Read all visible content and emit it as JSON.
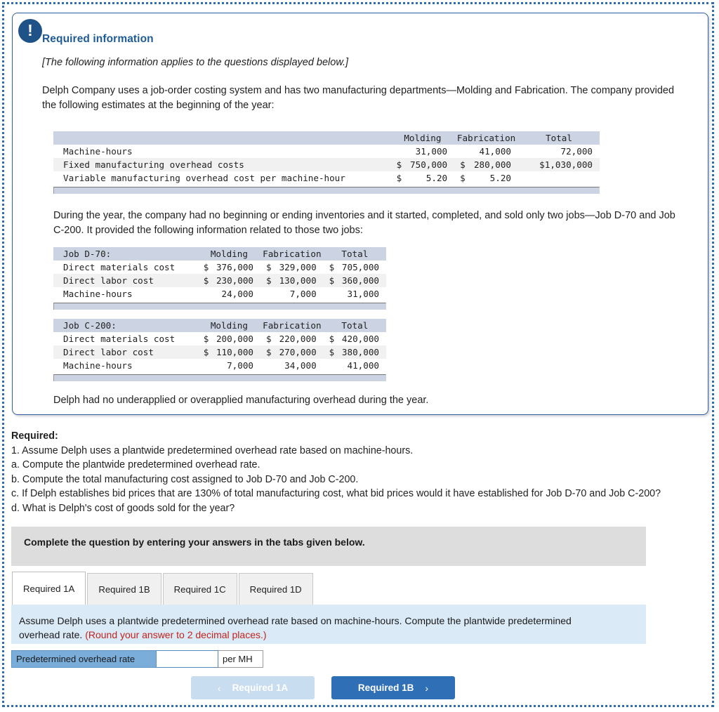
{
  "alert_icon": "exclamation-icon",
  "panel": {
    "title": "Required information",
    "note": "[The following information applies to the questions displayed below.]",
    "intro_para": "Delph Company uses a job-order costing system and has two manufacturing departments—Molding and Fabrication. The company provided the following estimates at the beginning of the year:",
    "during_para": "During the year, the company had no beginning or ending inventories and it started, completed, and sold only two jobs—Job D-70 and Job C-200. It provided the following information related to those two jobs:",
    "closing_para": "Delph had no underapplied or overapplied manufacturing overhead during the year."
  },
  "table_estimates": {
    "headers": [
      "",
      "Molding",
      "Fabrication",
      "Total"
    ],
    "rows": [
      {
        "label": "Machine-hours",
        "molding_cur": "",
        "molding": "31,000",
        "fab_cur": "",
        "fab": "41,000",
        "total_cur": "",
        "total": "72,000"
      },
      {
        "label": "Fixed manufacturing overhead costs",
        "molding_cur": "$",
        "molding": "750,000",
        "fab_cur": "$",
        "fab": "280,000",
        "total_cur": "",
        "total": "$1,030,000"
      },
      {
        "label": "Variable manufacturing overhead cost per machine-hour",
        "molding_cur": "$",
        "molding": "5.20",
        "fab_cur": "$",
        "fab": "5.20",
        "total_cur": "",
        "total": ""
      }
    ]
  },
  "table_d70": {
    "headers": [
      "Job D-70:",
      "Molding",
      "Fabrication",
      "Total"
    ],
    "rows": [
      {
        "label": "Direct materials cost",
        "molding_cur": "$",
        "molding": "376,000",
        "fab_cur": "$",
        "fab": "329,000",
        "total_cur": "$",
        "total": "705,000"
      },
      {
        "label": "Direct labor cost",
        "molding_cur": "$",
        "molding": "230,000",
        "fab_cur": "$",
        "fab": "130,000",
        "total_cur": "$",
        "total": "360,000"
      },
      {
        "label": "Machine-hours",
        "molding_cur": "",
        "molding": "24,000",
        "fab_cur": "",
        "fab": "7,000",
        "total_cur": "",
        "total": "31,000"
      }
    ]
  },
  "table_c200": {
    "headers": [
      "Job C-200:",
      "Molding",
      "Fabrication",
      "Total"
    ],
    "rows": [
      {
        "label": "Direct materials cost",
        "molding_cur": "$",
        "molding": "200,000",
        "fab_cur": "$",
        "fab": "220,000",
        "total_cur": "$",
        "total": "420,000"
      },
      {
        "label": "Direct labor cost",
        "molding_cur": "$",
        "molding": "110,000",
        "fab_cur": "$",
        "fab": "270,000",
        "total_cur": "$",
        "total": "380,000"
      },
      {
        "label": "Machine-hours",
        "molding_cur": "",
        "molding": "7,000",
        "fab_cur": "",
        "fab": "34,000",
        "total_cur": "",
        "total": "41,000"
      }
    ]
  },
  "required": {
    "heading": "Required:",
    "lines": [
      "1. Assume Delph uses a plantwide predetermined overhead rate based on machine-hours.",
      "a. Compute the plantwide predetermined overhead rate.",
      "b. Compute the total manufacturing cost assigned to Job D-70 and Job C-200.",
      "c. If Delph establishes bid prices that are 130% of total manufacturing cost, what bid prices would it have established for Job D-70 and Job C-200?",
      "d. What is Delph's cost of goods sold for the year?"
    ]
  },
  "complete_bar": {
    "text": "Complete the question by entering your answers in the tabs given below."
  },
  "tabs": [
    {
      "label": "Required 1A",
      "active": true
    },
    {
      "label": "Required 1B",
      "active": false
    },
    {
      "label": "Required 1C",
      "active": false
    },
    {
      "label": "Required 1D",
      "active": false
    }
  ],
  "prompt": {
    "text": "Assume Delph uses a plantwide predetermined overhead rate based on machine-hours. Compute the plantwide predetermined overhead rate.",
    "rounding_note": "(Round your answer to 2 decimal places.)"
  },
  "answer": {
    "label": "Predetermined overhead rate",
    "value": "",
    "placeholder": "",
    "unit": "per MH"
  },
  "nav": {
    "prev_label": "Required 1A",
    "prev_chevron": "‹",
    "next_label": "Required 1B",
    "next_chevron": "›"
  },
  "colors": {
    "accent_blue": "#2e6fb5",
    "title_blue": "#1f5c96",
    "table_header": "#ccd3e3",
    "prompt_bg": "#dbeaf7",
    "answer_label_bg": "#7badda",
    "red_note": "#c3231c"
  }
}
